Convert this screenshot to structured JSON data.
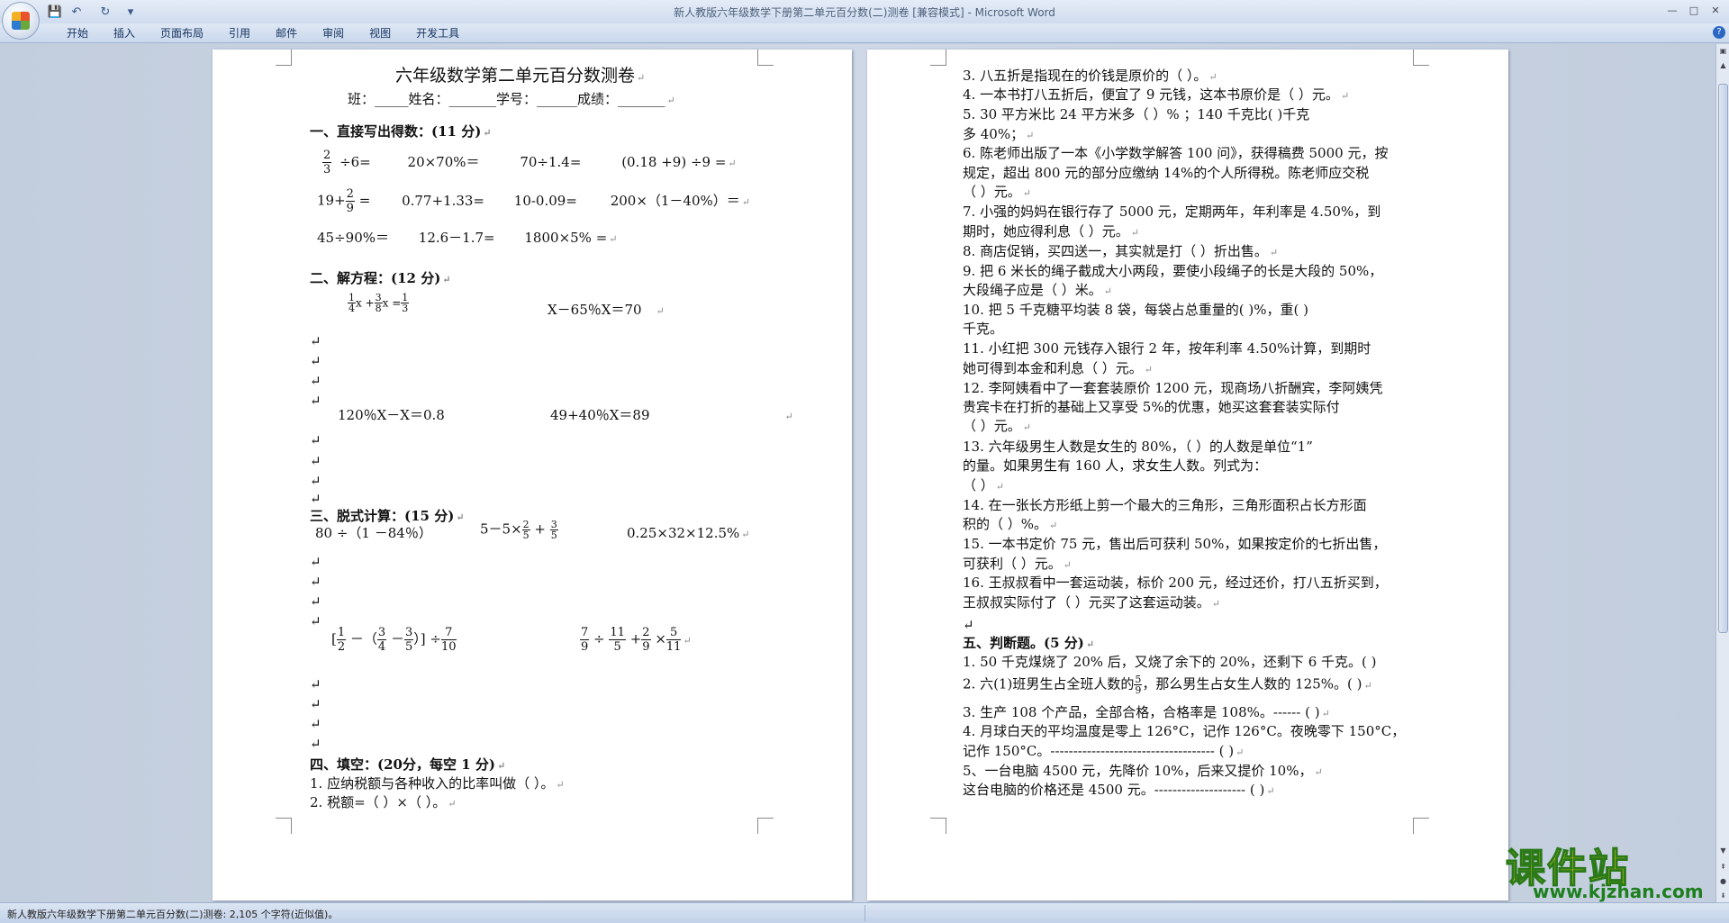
{
  "window": {
    "title": "新人教版六年级数学下册第二单元百分数(二)测卷 [兼容模式] - Microsoft Word",
    "controls": [
      "—",
      "□",
      "✕"
    ]
  },
  "quick_access": {
    "save_icon": "💾",
    "undo_icon": "↶",
    "redo_icon": "↻",
    "customize_icon": "▾"
  },
  "ribbon": {
    "tabs": [
      "开始",
      "插入",
      "页面布局",
      "引用",
      "邮件",
      "审阅",
      "视图",
      "开发工具"
    ],
    "help": "?"
  },
  "page1": {
    "title": "六年级数学第二单元百分数测卷",
    "info": "班：_____姓名：_______学号：______成绩：_______",
    "s1": {
      "heading": "一、直接写出得数：(11 分)",
      "r1": {
        "f_num": "2",
        "f_den": "3",
        "a": "÷6=",
        "b": "20×70%＝",
        "c": "70÷1.4=",
        "d": "(0.18 +9) ÷9 ="
      },
      "r2": {
        "pre": "19+",
        "f_num": "2",
        "f_den": "9",
        "a": " =",
        "b": "0.77+1.33=",
        "c": "10-0.09=",
        "d": "200×（1－40%）＝"
      },
      "r3": {
        "a": "45÷90%＝",
        "b": "12.6－1.7=",
        "c": "1800×5% ="
      }
    },
    "s2": {
      "heading": "二、解方程：(12 分)",
      "eq1": {
        "f1_num": "1",
        "f1_den": "4",
        "x1": "x +",
        "f2_num": "3",
        "f2_den": "8",
        "x2": "x =",
        "f3_num": "1",
        "f3_den": "3"
      },
      "eq2": "X－65％X＝70",
      "eq3": "120％X－X＝0.8",
      "eq4": "49+40％X＝89"
    },
    "s3": {
      "heading": "三、脱式计算：(15 分)",
      "e1": "80 ÷（1 －84％）",
      "e2": {
        "pre": "5－5×",
        "f1_num": "2",
        "f1_den": "5",
        "plus": " + ",
        "f2_num": "3",
        "f2_den": "5"
      },
      "e3": "0.25×32×12.5%",
      "e4": {
        "open": "[",
        "f1_num": "1",
        "f1_den": "2",
        "minus1": " －（",
        "f2_num": "3",
        "f2_den": "4",
        "minus2": " －",
        "f3_num": "3",
        "f3_den": "5",
        "close": "）] ÷",
        "f4_num": "7",
        "f4_den": "10"
      },
      "e5": {
        "f1_num": "7",
        "f1_den": "9",
        "div": " ÷ ",
        "f2_num": "11",
        "f2_den": "5",
        "plus": " +",
        "f3_num": "2",
        "f3_den": "9",
        "times": " ×",
        "f4_num": "5",
        "f4_den": "11"
      }
    },
    "s4": {
      "heading": "四、填空：(20分，每空 1 分)",
      "q1": "1. 应纳税额与各种收入的比率叫做（        ）。",
      "q2": "2. 税额=（     ）×（     ）。"
    },
    "return_mark": "↵"
  },
  "page2": {
    "lines": [
      "3. 八五折是指现在的价钱是原价的（        ）。",
      "4. 一本书打八五折后，便宜了 9 元钱，这本书原价是（        ）元。",
      "5. 30 平方米比 24 平方米多（       ）%  ；140 千克比(       )千克",
      "   多 40%；",
      "6. 陈老师出版了一本《小学数学解答 100 问》，获得稿费 5000 元，按",
      "   规定，超出 800 元的部分应缴纳 14%的个人所得税。陈老师应交税",
      "   （       ）元。",
      "7. 小强的妈妈在银行存了 5000 元，定期两年，年利率是 4.50%，到",
      "   期时，她应得利息（          ）元。",
      "8. 商店促销，买四送一，其实就是打（          ）折出售。",
      "9. 把 6 米长的绳子截成大小两段，要使小段绳子的长是大段的 50%，",
      "   大段绳子应是（      ）米。",
      "10. 把 5 千克糖平均装 8 袋，每袋占总重量的(        )%，重(       )",
      "    千克。",
      "11.  小红把 300 元钱存入银行 2 年，按年利率 4.50%计算，到期时",
      "    她可得到本金和利息（         ）元。",
      "12. 李阿姨看中了一套套装原价 1200 元，现商场八折酬宾，李阿姨凭",
      "    贵宾卡在打折的基础上又享受 5%的优惠，她买这套套装实际付",
      "    （       ）元。",
      "13. 六年级男生人数是女生的 80%，（       ）的人数是单位“1”",
      "    的量。如果男生有 160 人，求女生人数。列式为：",
      "    （                  ）",
      "14.  在一张长方形纸上剪一个最大的三角形，三角形面积占长方形面",
      "    积的（      ）%。",
      "15.  一本书定价 75 元，售出后可获利 50%，如果按定价的七折出售，",
      "    可获利（      ）元。",
      "16. 王叔叔看中一套运动装，标价 200 元，经过还价，打八五折买到，",
      "    王叔叔实际付了（          ）元买了这套运动装。"
    ],
    "s5_heading": "五、判断题。(5 分)",
    "j1": "1. 50 千克煤烧了 20% 后，又烧了余下的 20%，还剩下 6 千克。(     )",
    "j2": {
      "pre": "2. 六(1)班男生占全班人数的",
      "f_num": "5",
      "f_den": "9",
      "post": "，那么男生占女生人数的 125%。(      )"
    },
    "j3": "3. 生产 108 个产品，全部合格，合格率是 108%。------ (      )",
    "j4a": "4. 月球白天的平均温度是零上 126°C，记作 126°C。夜晚零下 150°C，",
    "j4b": "   记作 150°C。------------------------------------ (      )",
    "j5a": "5、一台电脑 4500 元，先降价 10%，后来又提价 10%，",
    "j5b": "   这台电脑的价格还是 4500 元。-------------------- (      )"
  },
  "status": {
    "text": "新人教版六年级数学下册第二单元百分数(二)测卷: 2,105 个字符(近似值)。"
  },
  "watermark": {
    "cn": "课件站",
    "url": "www.kjzhan.com"
  }
}
